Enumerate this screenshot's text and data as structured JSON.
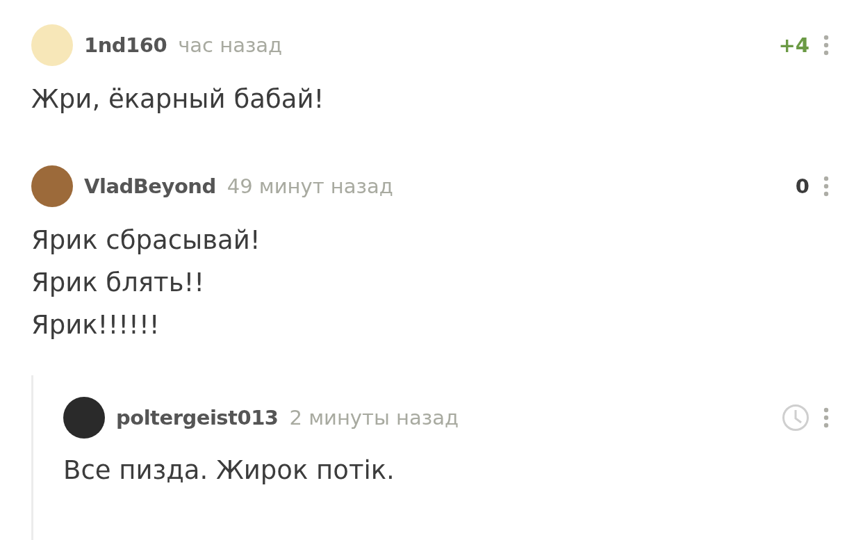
{
  "comments": [
    {
      "author": "1nd160",
      "time": "час назад",
      "rating": {
        "kind": "score",
        "text": "+4",
        "color": "#6b9a45"
      },
      "lines": [
        "Жри, ёкарный бабай!"
      ]
    },
    {
      "author": "VladBeyond",
      "time": "49 минут назад",
      "rating": {
        "kind": "score",
        "text": "0",
        "color": "#3c3c3c"
      },
      "lines": [
        "Ярик сбрасывай!",
        "Ярик блять!!",
        "Ярик!!!!!!"
      ],
      "children": [
        {
          "author": "poltergeist013",
          "time": "2 минуты назад",
          "rating": {
            "kind": "pending"
          },
          "lines": [
            "Все пизда. Жирок потік."
          ]
        }
      ]
    }
  ]
}
